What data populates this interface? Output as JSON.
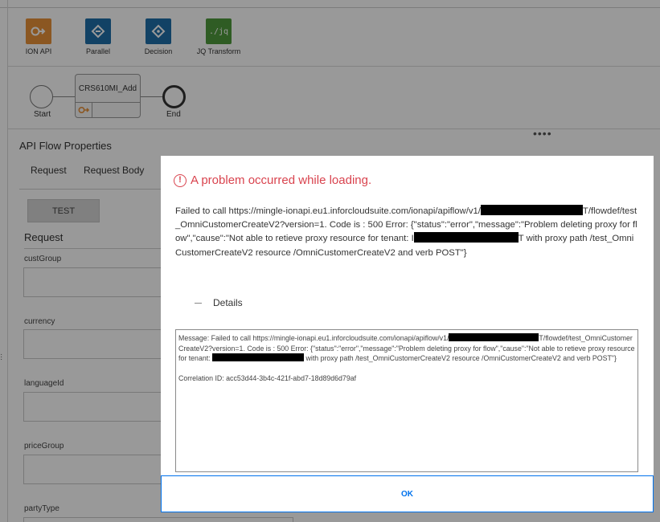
{
  "palette": [
    {
      "label": "ION API",
      "icon": "ion-api-icon",
      "color": "#e8913a"
    },
    {
      "label": "Parallel",
      "icon": "parallel-icon",
      "color": "#1e6ea8"
    },
    {
      "label": "Decision",
      "icon": "decision-icon",
      "color": "#1e6ea8"
    },
    {
      "label": "JQ Transform",
      "icon": "jq-transform-icon",
      "color": "#4f9a3c",
      "glyph": "./jq"
    }
  ],
  "flow": {
    "start_label": "Start",
    "node_title": "CRS610MI_Add",
    "end_label": "End"
  },
  "properties": {
    "title": "API Flow Properties",
    "tabs": [
      "Request",
      "Request Body"
    ],
    "test_label": "TEST",
    "request_heading": "Request",
    "fields": [
      "custGroup",
      "currency",
      "languageId",
      "priceGroup",
      "partyType"
    ]
  },
  "dialog": {
    "title": "A problem occurred while loading.",
    "message_parts": [
      "Failed to call https://mingle-ionapi.eu1.inforcloudsuite.com/ionapi/apiflow/v1/",
      "T/flowdef/test_OmniCustomerCreateV2?version=1. Code is : 500 Error: {\"status\":\"error\",\"message\":\"Problem deleting proxy for flow\",\"cause\":\"Not able to retieve proxy resource  for tenant: I",
      "T with proxy path /test_OmniCustomerCreateV2 resource /OmniCustomerCreateV2 and verb POST\"}"
    ],
    "details_label": "Details",
    "details_parts": [
      "Message: Failed to call https://mingle-ionapi.eu1.inforcloudsuite.com/ionapi/apiflow/v1/",
      "T/flowdef/test_OmniCustomerCreateV2?version=1. Code is : 500 Error: {\"status\":\"error\",\"message\":\"Problem deleting proxy for flow\",\"cause\":\"Not able to retieve proxy resource  for tenant: ",
      " with proxy path /test_OmniCustomerCreateV2 resource /OmniCustomerCreateV2 and verb POST\"}"
    ],
    "correlation": "Correlation ID: acc53d44-3b4c-421f-abd7-18d89d6d79af",
    "ok_label": "OK"
  },
  "colors": {
    "error": "#d9434e",
    "accent": "#0072ed"
  }
}
